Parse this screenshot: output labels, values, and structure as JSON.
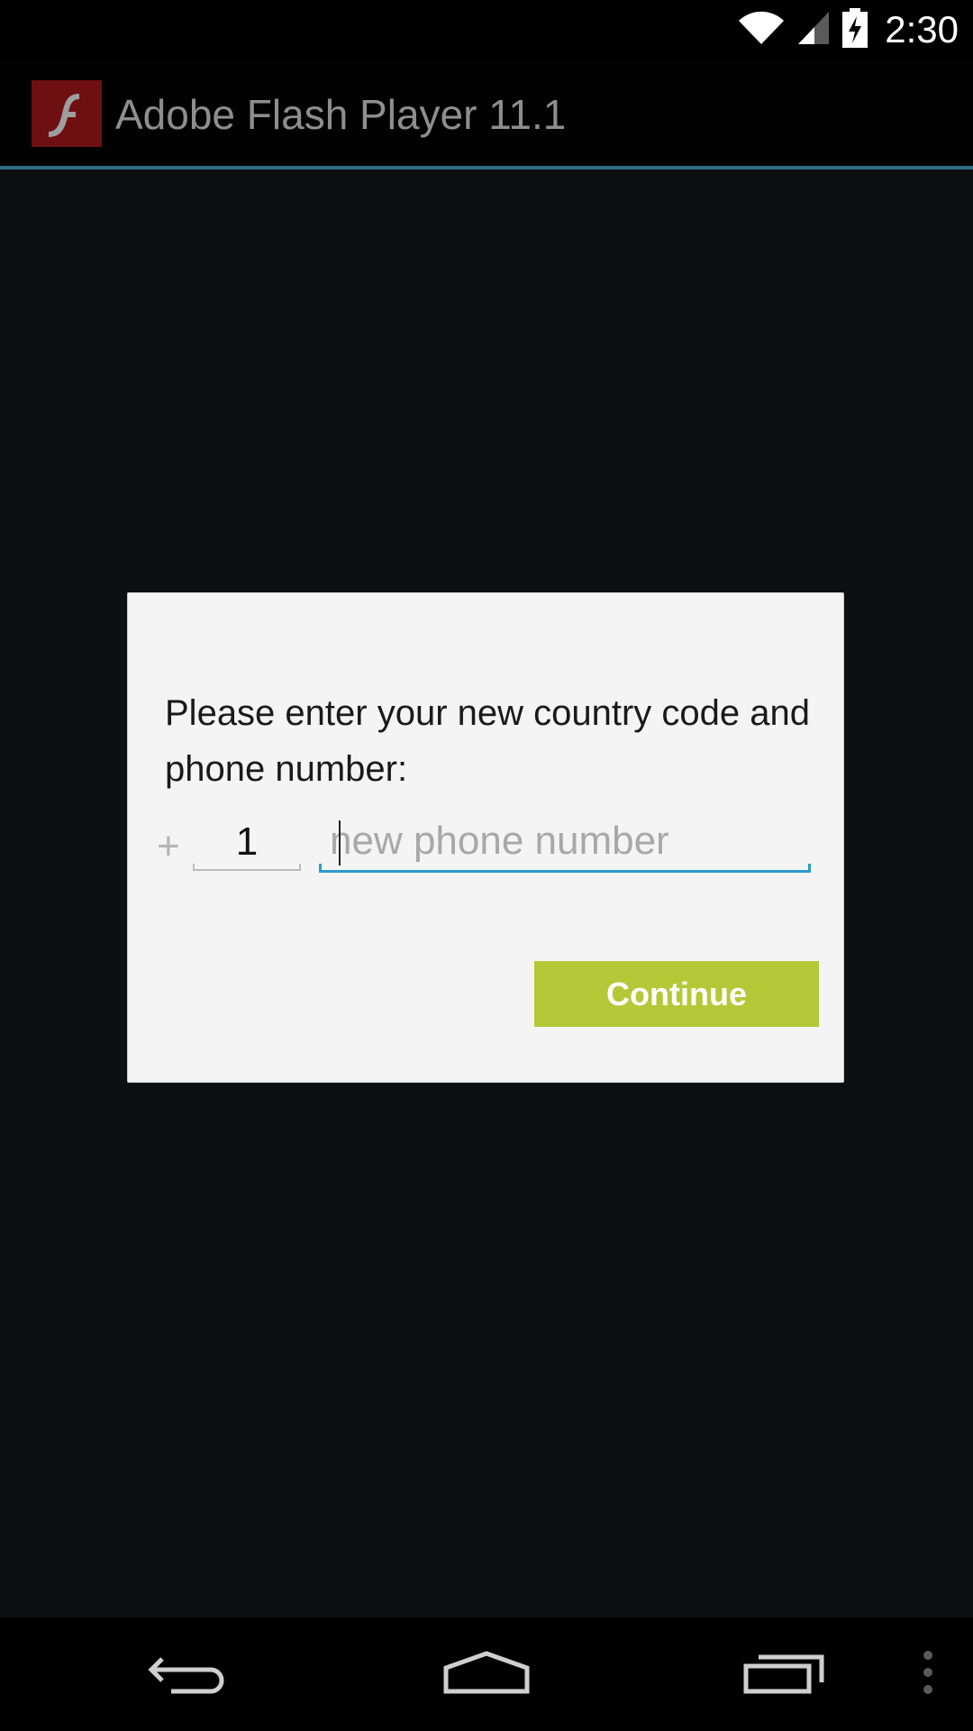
{
  "status_bar": {
    "time": "2:30",
    "icons": [
      "wifi-icon",
      "cell-signal-icon",
      "battery-charging-icon"
    ]
  },
  "action_bar": {
    "app_icon": "flash-player-icon",
    "title": "Adobe Flash Player 11.1"
  },
  "dialog": {
    "message": "Please enter your new country code and phone number:",
    "plus_sign": "+",
    "country_code_value": "1",
    "phone_value": "",
    "phone_placeholder": "new phone number",
    "continue_label": "Continue"
  },
  "nav_bar": {
    "icons": [
      "back-icon",
      "home-icon",
      "recent-apps-icon",
      "overflow-menu-icon"
    ]
  },
  "colors": {
    "background": "#0e0f11",
    "accent_underline": "#2c9ccc",
    "continue_button": "#b3c938",
    "action_bar_divider": "#2f6b85"
  }
}
